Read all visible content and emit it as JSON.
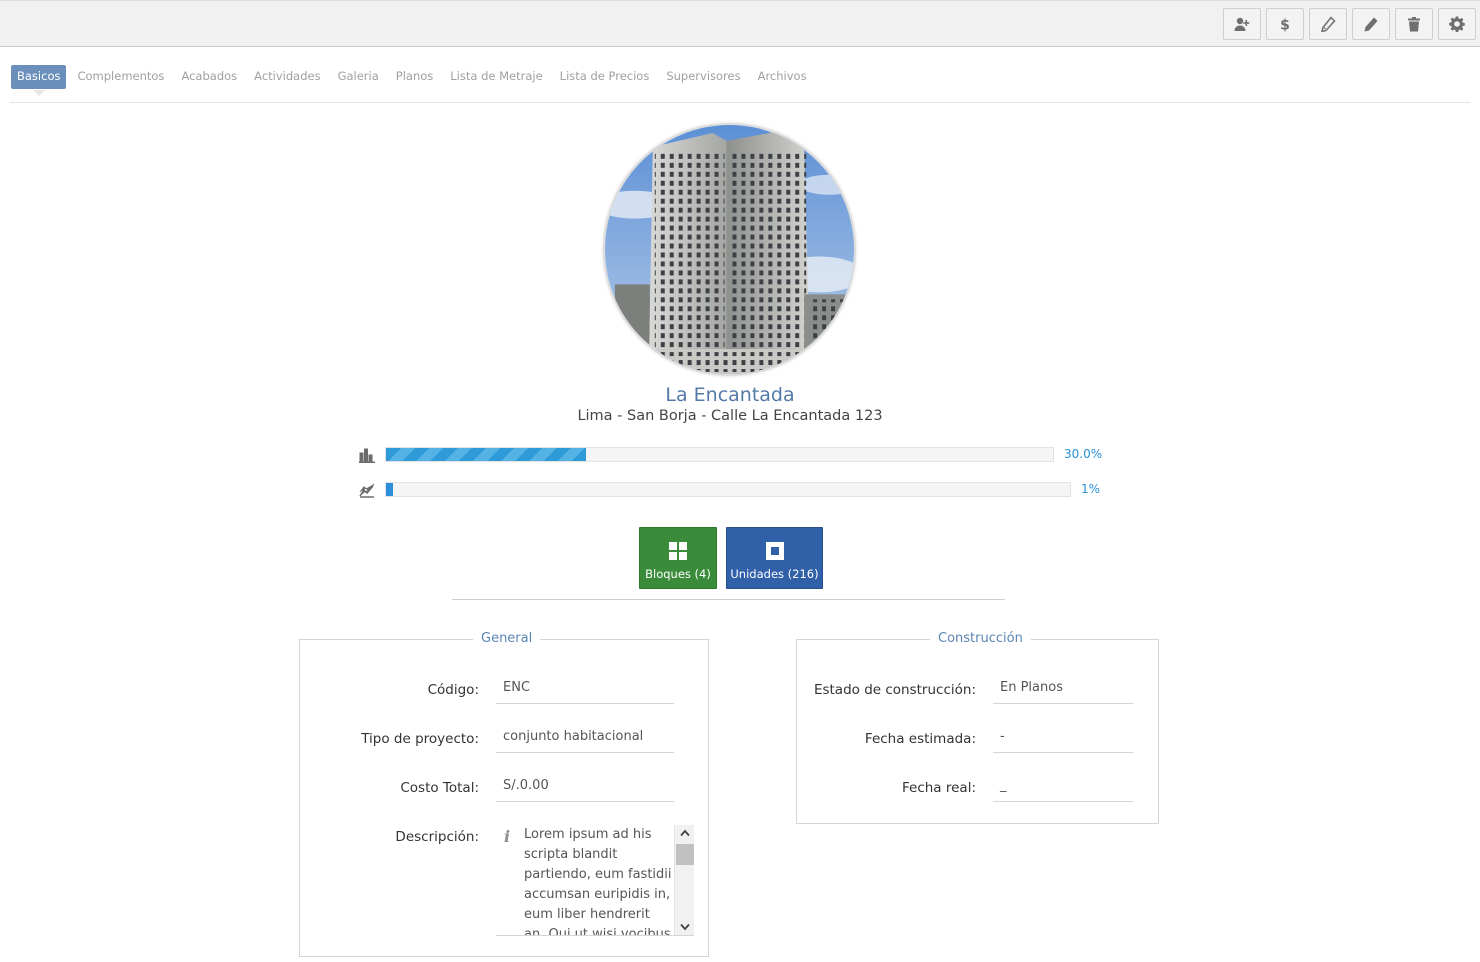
{
  "toolbar": {
    "buttons": [
      {
        "name": "add-user-button",
        "icon": "add-user-icon"
      },
      {
        "name": "price-button",
        "icon": "dollar-icon"
      },
      {
        "name": "edit-pencil-button",
        "icon": "pencil-icon"
      },
      {
        "name": "edit-button",
        "icon": "edit-icon"
      },
      {
        "name": "delete-button",
        "icon": "trash-icon"
      },
      {
        "name": "settings-button",
        "icon": "gear-icon"
      }
    ]
  },
  "tabs": [
    {
      "label": "Basicos",
      "active": true
    },
    {
      "label": "Complementos",
      "active": false
    },
    {
      "label": "Acabados",
      "active": false
    },
    {
      "label": "Actividades",
      "active": false
    },
    {
      "label": "Galeria",
      "active": false
    },
    {
      "label": "Planos",
      "active": false
    },
    {
      "label": "Lista de Metraje",
      "active": false
    },
    {
      "label": "Lista de Precios",
      "active": false
    },
    {
      "label": "Supervisores",
      "active": false
    },
    {
      "label": "Archivos",
      "active": false
    }
  ],
  "project": {
    "name": "La Encantada",
    "address": "Lima - San Borja - Calle La Encantada 123"
  },
  "progress": {
    "sales": {
      "icon": "bar-chart-icon",
      "value": 0.3,
      "text": "30.0%"
    },
    "construction": {
      "icon": "trend-chart-icon",
      "value": 0.01,
      "text": "1%"
    }
  },
  "actions": {
    "blocks_label": "Bloques (4)",
    "units_label": "Unidades (216)"
  },
  "general": {
    "legend": "General",
    "code_label": "Código:",
    "code_value": "ENC",
    "type_label": "Tipo de proyecto:",
    "type_value": "conjunto habitacional",
    "cost_label": "Costo Total:",
    "cost_value": "S/.0.00",
    "description_label": "Descripción:",
    "description_value": "Lorem ipsum ad his scripta blandit partiendo, eum fastidii accumsan euripidis in, eum liber hendrerit an. Qui ut wisi vocibus"
  },
  "construction": {
    "legend": "Construcción",
    "status_label": "Estado de construcción:",
    "status_value": "En Planos",
    "estimated_label": "Fecha estimada:",
    "estimated_value": "-",
    "real_label": "Fecha real:",
    "real_value": "_"
  },
  "colors": {
    "accent": "#6a8fba",
    "title": "#5379a8",
    "green_button": "#3a8c3a",
    "blue_button": "#3060a8",
    "progress": "#2e9ad8"
  }
}
